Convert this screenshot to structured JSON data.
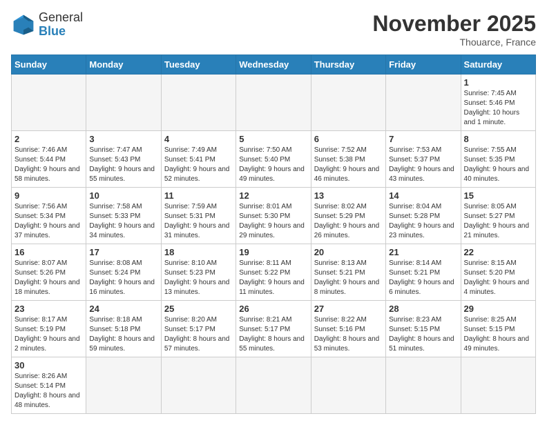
{
  "header": {
    "logo_general": "General",
    "logo_blue": "Blue",
    "month_title": "November 2025",
    "location": "Thouarce, France"
  },
  "weekdays": [
    "Sunday",
    "Monday",
    "Tuesday",
    "Wednesday",
    "Thursday",
    "Friday",
    "Saturday"
  ],
  "days": [
    {
      "num": "",
      "info": ""
    },
    {
      "num": "",
      "info": ""
    },
    {
      "num": "",
      "info": ""
    },
    {
      "num": "",
      "info": ""
    },
    {
      "num": "",
      "info": ""
    },
    {
      "num": "",
      "info": ""
    },
    {
      "num": "1",
      "info": "Sunrise: 7:45 AM\nSunset: 5:46 PM\nDaylight: 10 hours and 1 minute."
    },
    {
      "num": "2",
      "info": "Sunrise: 7:46 AM\nSunset: 5:44 PM\nDaylight: 9 hours and 58 minutes."
    },
    {
      "num": "3",
      "info": "Sunrise: 7:47 AM\nSunset: 5:43 PM\nDaylight: 9 hours and 55 minutes."
    },
    {
      "num": "4",
      "info": "Sunrise: 7:49 AM\nSunset: 5:41 PM\nDaylight: 9 hours and 52 minutes."
    },
    {
      "num": "5",
      "info": "Sunrise: 7:50 AM\nSunset: 5:40 PM\nDaylight: 9 hours and 49 minutes."
    },
    {
      "num": "6",
      "info": "Sunrise: 7:52 AM\nSunset: 5:38 PM\nDaylight: 9 hours and 46 minutes."
    },
    {
      "num": "7",
      "info": "Sunrise: 7:53 AM\nSunset: 5:37 PM\nDaylight: 9 hours and 43 minutes."
    },
    {
      "num": "8",
      "info": "Sunrise: 7:55 AM\nSunset: 5:35 PM\nDaylight: 9 hours and 40 minutes."
    },
    {
      "num": "9",
      "info": "Sunrise: 7:56 AM\nSunset: 5:34 PM\nDaylight: 9 hours and 37 minutes."
    },
    {
      "num": "10",
      "info": "Sunrise: 7:58 AM\nSunset: 5:33 PM\nDaylight: 9 hours and 34 minutes."
    },
    {
      "num": "11",
      "info": "Sunrise: 7:59 AM\nSunset: 5:31 PM\nDaylight: 9 hours and 31 minutes."
    },
    {
      "num": "12",
      "info": "Sunrise: 8:01 AM\nSunset: 5:30 PM\nDaylight: 9 hours and 29 minutes."
    },
    {
      "num": "13",
      "info": "Sunrise: 8:02 AM\nSunset: 5:29 PM\nDaylight: 9 hours and 26 minutes."
    },
    {
      "num": "14",
      "info": "Sunrise: 8:04 AM\nSunset: 5:28 PM\nDaylight: 9 hours and 23 minutes."
    },
    {
      "num": "15",
      "info": "Sunrise: 8:05 AM\nSunset: 5:27 PM\nDaylight: 9 hours and 21 minutes."
    },
    {
      "num": "16",
      "info": "Sunrise: 8:07 AM\nSunset: 5:26 PM\nDaylight: 9 hours and 18 minutes."
    },
    {
      "num": "17",
      "info": "Sunrise: 8:08 AM\nSunset: 5:24 PM\nDaylight: 9 hours and 16 minutes."
    },
    {
      "num": "18",
      "info": "Sunrise: 8:10 AM\nSunset: 5:23 PM\nDaylight: 9 hours and 13 minutes."
    },
    {
      "num": "19",
      "info": "Sunrise: 8:11 AM\nSunset: 5:22 PM\nDaylight: 9 hours and 11 minutes."
    },
    {
      "num": "20",
      "info": "Sunrise: 8:13 AM\nSunset: 5:21 PM\nDaylight: 9 hours and 8 minutes."
    },
    {
      "num": "21",
      "info": "Sunrise: 8:14 AM\nSunset: 5:21 PM\nDaylight: 9 hours and 6 minutes."
    },
    {
      "num": "22",
      "info": "Sunrise: 8:15 AM\nSunset: 5:20 PM\nDaylight: 9 hours and 4 minutes."
    },
    {
      "num": "23",
      "info": "Sunrise: 8:17 AM\nSunset: 5:19 PM\nDaylight: 9 hours and 2 minutes."
    },
    {
      "num": "24",
      "info": "Sunrise: 8:18 AM\nSunset: 5:18 PM\nDaylight: 8 hours and 59 minutes."
    },
    {
      "num": "25",
      "info": "Sunrise: 8:20 AM\nSunset: 5:17 PM\nDaylight: 8 hours and 57 minutes."
    },
    {
      "num": "26",
      "info": "Sunrise: 8:21 AM\nSunset: 5:17 PM\nDaylight: 8 hours and 55 minutes."
    },
    {
      "num": "27",
      "info": "Sunrise: 8:22 AM\nSunset: 5:16 PM\nDaylight: 8 hours and 53 minutes."
    },
    {
      "num": "28",
      "info": "Sunrise: 8:23 AM\nSunset: 5:15 PM\nDaylight: 8 hours and 51 minutes."
    },
    {
      "num": "29",
      "info": "Sunrise: 8:25 AM\nSunset: 5:15 PM\nDaylight: 8 hours and 49 minutes."
    },
    {
      "num": "30",
      "info": "Sunrise: 8:26 AM\nSunset: 5:14 PM\nDaylight: 8 hours and 48 minutes."
    },
    {
      "num": "",
      "info": ""
    },
    {
      "num": "",
      "info": ""
    },
    {
      "num": "",
      "info": ""
    },
    {
      "num": "",
      "info": ""
    },
    {
      "num": "",
      "info": ""
    },
    {
      "num": "",
      "info": ""
    }
  ]
}
